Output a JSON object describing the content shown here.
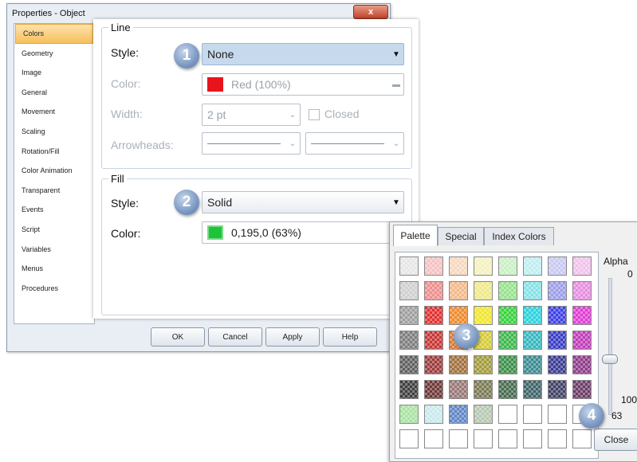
{
  "dialog": {
    "title": "Properties - Object",
    "close_label": "x",
    "sidebar": [
      "Colors",
      "Geometry",
      "Image",
      "General",
      "Movement",
      "Scaling",
      "Rotation/Fill",
      "Color Animation",
      "Transparent",
      "Events",
      "Script",
      "Variables",
      "Menus",
      "Procedures"
    ],
    "selected_sidebar_item": "Colors",
    "line": {
      "group_title": "Line",
      "style_label": "Style:",
      "style_value": "None",
      "color_label": "Color:",
      "color_value": "Red (100%)",
      "color_swatch": "#e8141b",
      "width_label": "Width:",
      "width_value": "2 pt",
      "closed_label": "Closed",
      "arrowheads_label": "Arrowheads:"
    },
    "fill": {
      "group_title": "Fill",
      "style_label": "Style:",
      "style_value": "Solid",
      "color_label": "Color:",
      "color_value": "0,195,0 (63%)",
      "color_swatch": "#1fc33a"
    },
    "buttons": {
      "ok": "OK",
      "cancel": "Cancel",
      "apply": "Apply",
      "help": "Help"
    }
  },
  "badges": [
    "1",
    "2",
    "3",
    "4"
  ],
  "palette": {
    "tabs": [
      "Palette",
      "Special",
      "Index Colors"
    ],
    "active_tab": "Palette",
    "alpha_label": "Alpha",
    "alpha_min": "0",
    "alpha_max": "100",
    "alpha_value": "63",
    "close_label": "Close",
    "rows": [
      [
        "#e6e6e6",
        "#f4c1c1",
        "#f6d8bf",
        "#f4f1bd",
        "#c9efc3",
        "#bfeef0",
        "#c8c9f1",
        "#f1c2ec"
      ],
      [
        "#cfcfcf",
        "#ef8d8d",
        "#f2b988",
        "#efe889",
        "#96e38c",
        "#86e2e6",
        "#9c9ee8",
        "#e78ee0"
      ],
      [
        "#9e9e9e",
        "#e23030",
        "#ee8a2c",
        "#f1e52b",
        "#36d23b",
        "#2bd2dd",
        "#3d40e4",
        "#e03cd4"
      ],
      [
        "#7d7d7d",
        "#c83434",
        "#d67a35",
        "#d4cc34",
        "#3bb84a",
        "#35b7c0",
        "#383cc4",
        "#c03cb8"
      ],
      [
        "#5f5f5f",
        "#9c3b3b",
        "#a0703e",
        "#a29b3a",
        "#3b8f48",
        "#3a8b90",
        "#3a3c93",
        "#8f3a8a"
      ],
      [
        "#3e3e3e",
        "#6e3636",
        "#9a7676",
        "#7a7a52",
        "#456c4e",
        "#3d6468",
        "#3f4066",
        "#6c3b68"
      ],
      [
        "#a9e3a2",
        "#c9e9ec",
        "#5f86c4",
        "#b7c8b0",
        "#ffffff",
        "#ffffff",
        "#ffffff",
        "#ffffff"
      ],
      [
        "#ffffff",
        "#ffffff",
        "#ffffff",
        "#ffffff",
        "#ffffff",
        "#ffffff",
        "#ffffff",
        "#ffffff"
      ]
    ]
  }
}
